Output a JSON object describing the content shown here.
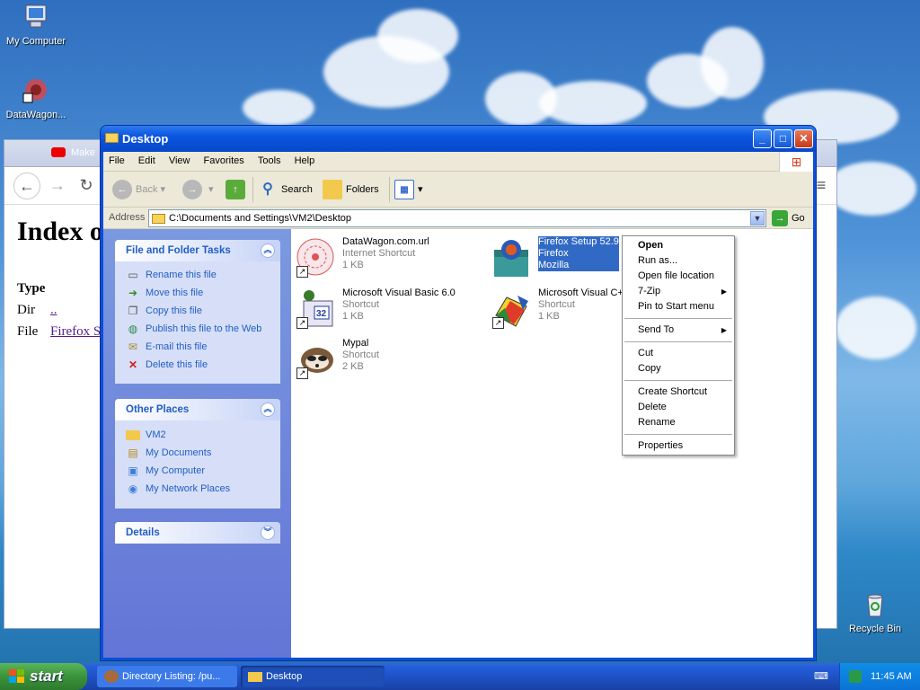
{
  "desktop": {
    "icons": [
      {
        "label": "My Computer"
      },
      {
        "label": "DataWagon..."
      },
      {
        "label": "Recycle Bin"
      }
    ]
  },
  "browser": {
    "tab_title": "Make",
    "heading": "Index o",
    "type_header": "Type",
    "rows": [
      {
        "type": "Dir",
        "name": ".."
      },
      {
        "type": "File",
        "name": "Firefox S"
      }
    ]
  },
  "explorer": {
    "title": "Desktop",
    "menu": [
      "File",
      "Edit",
      "View",
      "Favorites",
      "Tools",
      "Help"
    ],
    "toolbar": {
      "back": "Back",
      "search": "Search",
      "folders": "Folders"
    },
    "address": {
      "label": "Address",
      "value": "C:\\Documents and Settings\\VM2\\Desktop",
      "go": "Go"
    },
    "panels": {
      "file_tasks": {
        "title": "File and Folder Tasks",
        "items": [
          {
            "label": "Rename this file",
            "icon": "rename-icon"
          },
          {
            "label": "Move this file",
            "icon": "move-icon"
          },
          {
            "label": "Copy this file",
            "icon": "copy-icon"
          },
          {
            "label": "Publish this file to the Web",
            "icon": "globe-icon"
          },
          {
            "label": "E-mail this file",
            "icon": "email-icon"
          },
          {
            "label": "Delete this file",
            "icon": "delete-icon"
          }
        ]
      },
      "other_places": {
        "title": "Other Places",
        "items": [
          {
            "label": "VM2",
            "icon": "folder-icon"
          },
          {
            "label": "My Documents",
            "icon": "documents-icon"
          },
          {
            "label": "My Computer",
            "icon": "computer-icon"
          },
          {
            "label": "My Network Places",
            "icon": "network-icon"
          }
        ]
      },
      "details": {
        "title": "Details"
      }
    },
    "files": [
      {
        "name": "DataWagon.com.url",
        "type": "Internet Shortcut",
        "size": "1 KB",
        "selected": false
      },
      {
        "name": "Firefox Setup 52.9",
        "type": "Firefox",
        "size": "Mozilla",
        "selected": true
      },
      {
        "name": "Microsoft Visual Basic 6.0",
        "type": "Shortcut",
        "size": "1 KB",
        "selected": false
      },
      {
        "name": "Microsoft Visual C+",
        "type": "Shortcut",
        "size": "1 KB",
        "selected": false
      },
      {
        "name": "Mypal",
        "type": "Shortcut",
        "size": "2 KB",
        "selected": false
      }
    ]
  },
  "context_menu": {
    "groups": [
      [
        "Open",
        "Run as...",
        "Open file location",
        "7-Zip",
        "Pin to Start menu"
      ],
      [
        "Send To"
      ],
      [
        "Cut",
        "Copy"
      ],
      [
        "Create Shortcut",
        "Delete",
        "Rename"
      ],
      [
        "Properties"
      ]
    ]
  },
  "taskbar": {
    "start": "start",
    "tasks": [
      {
        "label": "Directory Listing: /pu..."
      },
      {
        "label": "Desktop"
      }
    ],
    "clock": "11:45 AM"
  }
}
